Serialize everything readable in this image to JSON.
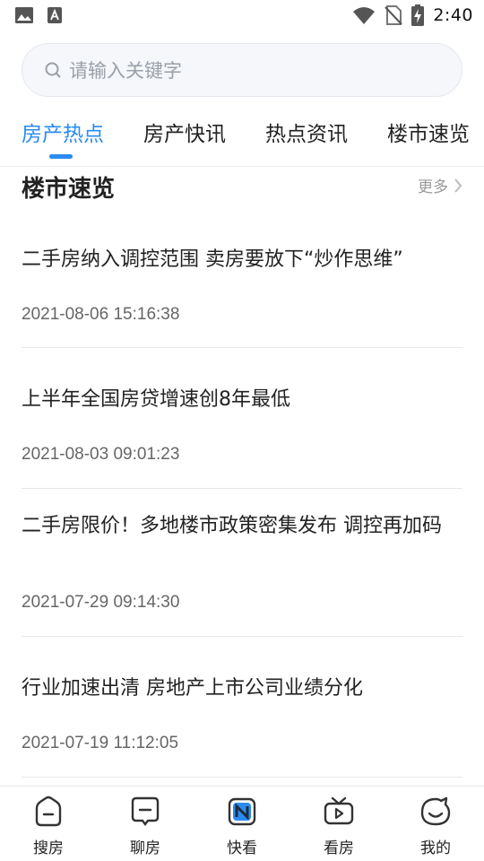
{
  "status_bar": {
    "time": "2:40",
    "left_icons": [
      "image-icon",
      "a-badge-icon"
    ],
    "right_icons": [
      "wifi-icon",
      "no-sim-icon",
      "battery-charging-icon"
    ]
  },
  "search": {
    "placeholder": "请输入关键字"
  },
  "tabs": [
    {
      "label": "房产热点",
      "active": true
    },
    {
      "label": "房产快讯",
      "active": false
    },
    {
      "label": "热点资讯",
      "active": false
    },
    {
      "label": "楼市速览",
      "active": false
    }
  ],
  "section": {
    "title": "楼市速览",
    "more_label": "更多"
  },
  "news": [
    {
      "title": "二手房纳入调控范围 卖房要放下“炒作思维”",
      "time": "2021-08-06 15:16:38"
    },
    {
      "title": "上半年全国房贷增速创8年最低",
      "time": "2021-08-03 09:01:23"
    },
    {
      "title": "二手房限价！多地楼市政策密集发布 调控再加码",
      "time": "2021-07-29 09:14:30"
    },
    {
      "title": "行业加速出清 房地产上市公司业绩分化",
      "time": "2021-07-19 11:12:05"
    }
  ],
  "bottom_nav": [
    {
      "label": "搜房",
      "icon": "search-house-icon",
      "active": false
    },
    {
      "label": "聊房",
      "icon": "chat-house-icon",
      "active": false
    },
    {
      "label": "快看",
      "icon": "quick-look-icon",
      "active": true
    },
    {
      "label": "看房",
      "icon": "view-house-icon",
      "active": false
    },
    {
      "label": "我的",
      "icon": "profile-icon",
      "active": false
    }
  ],
  "colors": {
    "accent": "#2a8bf2",
    "text": "#222222",
    "muted": "#999999"
  }
}
